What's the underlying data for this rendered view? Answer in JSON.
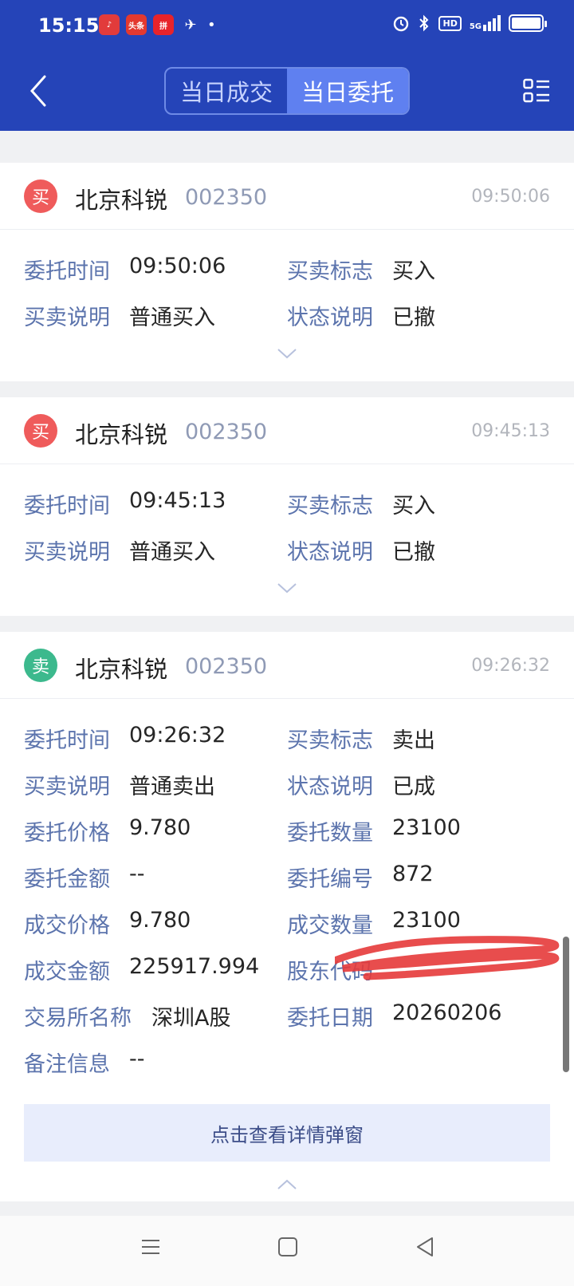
{
  "status_bar": {
    "time": "15:15",
    "app_icons": [
      "music-app-icon",
      "toutiao-app-icon",
      "pinduoduo-app-icon",
      "send-app-icon"
    ],
    "app_icon_text": [
      "♪",
      "头条",
      "拼",
      "✈"
    ],
    "dot": "•",
    "signal_text": "5G",
    "hd": "HD"
  },
  "header": {
    "tabs": [
      {
        "label": "当日成交",
        "active": false
      },
      {
        "label": "当日委托",
        "active": true
      }
    ]
  },
  "orders": [
    {
      "side": "买",
      "name": "北京科锐",
      "code": "002350",
      "time": "09:50:06",
      "fields": [
        {
          "label": "委托时间",
          "value": "09:50:06"
        },
        {
          "label": "买卖标志",
          "value": "买入"
        },
        {
          "label": "买卖说明",
          "value": "普通买入"
        },
        {
          "label": "状态说明",
          "value": "已撤"
        }
      ]
    },
    {
      "side": "买",
      "name": "北京科锐",
      "code": "002350",
      "time": "09:45:13",
      "fields": [
        {
          "label": "委托时间",
          "value": "09:45:13"
        },
        {
          "label": "买卖标志",
          "value": "买入"
        },
        {
          "label": "买卖说明",
          "value": "普通买入"
        },
        {
          "label": "状态说明",
          "value": "已撤"
        }
      ]
    },
    {
      "side": "卖",
      "name": "北京科锐",
      "code": "002350",
      "time": "09:26:32",
      "fields": [
        {
          "label": "委托时间",
          "value": "09:26:32"
        },
        {
          "label": "买卖标志",
          "value": "卖出"
        },
        {
          "label": "买卖说明",
          "value": "普通卖出"
        },
        {
          "label": "状态说明",
          "value": "已成"
        },
        {
          "label": "委托价格",
          "value": "9.780"
        },
        {
          "label": "委托数量",
          "value": "23100"
        },
        {
          "label": "委托金额",
          "value": "--"
        },
        {
          "label": "委托编号",
          "value": "872"
        },
        {
          "label": "成交价格",
          "value": "9.780"
        },
        {
          "label": "成交数量",
          "value": "23100"
        },
        {
          "label": "成交金额",
          "value": "225917.994"
        },
        {
          "label": "股东代码",
          "value": ""
        },
        {
          "label": "交易所名称",
          "value": "深圳A股"
        },
        {
          "label": "委托日期",
          "value": "20260206"
        },
        {
          "label": "备注信息",
          "value": "--"
        }
      ],
      "detail_button": "点击查看详情弹窗"
    }
  ],
  "colors": {
    "header_bg": "#2544b8",
    "buy_badge": "#ef5b5b",
    "sell_badge": "#3cb98d",
    "label": "#5c74ad"
  }
}
